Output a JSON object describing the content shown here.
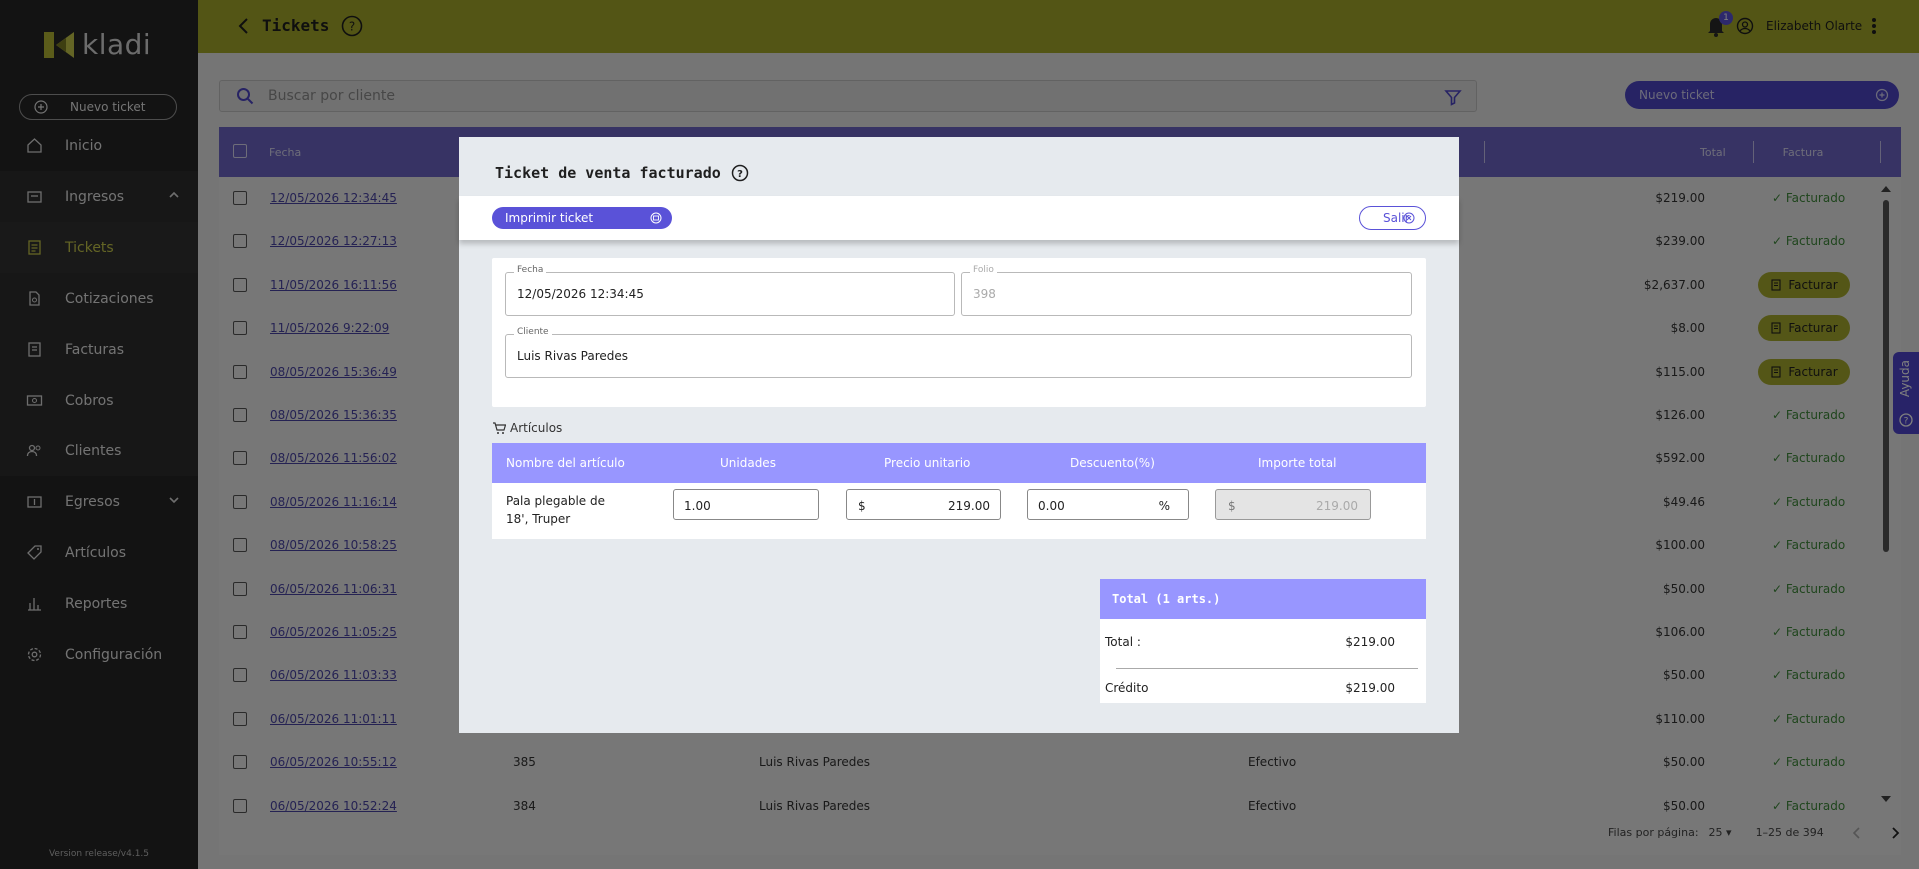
{
  "app": {
    "logo_text": "kladi",
    "version": "Version release/v4.1.5",
    "brand_color": "#a7ab2a",
    "accent_color": "#5a52d8"
  },
  "sidebar": {
    "new_ticket": "Nuevo ticket",
    "items": [
      {
        "label": "Inicio",
        "icon": "home-icon"
      },
      {
        "label": "Ingresos",
        "icon": "cash-register-icon"
      },
      {
        "label": "Tickets",
        "icon": "receipt-icon"
      },
      {
        "label": "Cotizaciones",
        "icon": "document-icon"
      },
      {
        "label": "Facturas",
        "icon": "invoice-icon"
      },
      {
        "label": "Cobros",
        "icon": "money-icon"
      },
      {
        "label": "Clientes",
        "icon": "users-icon"
      },
      {
        "label": "Egresos",
        "icon": "expense-icon"
      },
      {
        "label": "Artículos",
        "icon": "tag-icon"
      },
      {
        "label": "Reportes",
        "icon": "chart-icon"
      },
      {
        "label": "Configuración",
        "icon": "gear-icon"
      }
    ]
  },
  "topbar": {
    "title": "Tickets",
    "notifications": "1",
    "user": "Elizabeth Olarte"
  },
  "search": {
    "placeholder": "Buscar por cliente"
  },
  "new_ticket_button": "Nuevo ticket",
  "table": {
    "headers": {
      "fecha": "Fecha",
      "total": "Total",
      "factura": "Factura"
    },
    "facturado_label": "✓ Facturado",
    "facturar_label": "Facturar",
    "rows": [
      {
        "date": "12/05/2026   12:34:45",
        "total": "$219.00",
        "status": "facturado"
      },
      {
        "date": "12/05/2026   12:27:13",
        "total": "$239.00",
        "status": "facturado"
      },
      {
        "date": "11/05/2026   16:11:56",
        "total": "$2,637.00",
        "status": "facturar"
      },
      {
        "date": "11/05/2026   9:22:09",
        "total": "$8.00",
        "status": "facturar"
      },
      {
        "date": "08/05/2026   15:36:49",
        "total": "$115.00",
        "status": "facturar"
      },
      {
        "date": "08/05/2026   15:36:35",
        "total": "$126.00",
        "status": "facturado"
      },
      {
        "date": "08/05/2026   11:56:02",
        "total": "$592.00",
        "status": "facturado"
      },
      {
        "date": "08/05/2026   11:16:14",
        "total": "$49.46",
        "status": "facturado"
      },
      {
        "date": "08/05/2026   10:58:25",
        "total": "$100.00",
        "status": "facturado"
      },
      {
        "date": "06/05/2026   11:06:31",
        "total": "$50.00",
        "status": "facturado"
      },
      {
        "date": "06/05/2026   11:05:25",
        "total": "$106.00",
        "status": "facturado"
      },
      {
        "date": "06/05/2026   11:03:33",
        "total": "$50.00",
        "status": "facturado"
      },
      {
        "date": "06/05/2026   11:01:11",
        "total": "$110.00",
        "status": "facturado"
      },
      {
        "date": "06/05/2026   10:55:12",
        "folio": "385",
        "client": "Luis Rivas Paredes",
        "method": "Efectivo",
        "total": "$50.00",
        "status": "facturado"
      },
      {
        "date": "06/05/2026   10:52:24",
        "folio": "384",
        "client": "Luis Rivas Paredes",
        "method": "Efectivo",
        "total": "$50.00",
        "status": "facturado"
      }
    ]
  },
  "pager": {
    "rows_label": "Filas por página:",
    "rows_value": "25",
    "range": "1–25 de 394"
  },
  "help_tab": "Ayuda",
  "modal": {
    "title": "Ticket de venta facturado",
    "print_button": "Imprimir ticket",
    "exit_button": "Salir",
    "fecha_label": "Fecha",
    "fecha_value": "12/05/2026   12:34:45",
    "folio_label": "Folio",
    "folio_value": "398",
    "cliente_label": "Cliente",
    "cliente_value": "Luis Rivas Paredes",
    "articles_label": "Artículos",
    "articles_headers": {
      "name": "Nombre del artículo",
      "units": "Unidades",
      "price": "Precio unitario",
      "discount": "Descuento(%)",
      "amount": "Importe total"
    },
    "article": {
      "name": "Pala plegable de 18', Truper",
      "units": "1.00",
      "currency": "$",
      "price": "219.00",
      "discount": "0.00",
      "percent": "%",
      "amount": "219.00"
    },
    "totals_title": "Total (1 arts.)",
    "total_label": "Total :",
    "total_value": "$219.00",
    "credit_label": "Crédito",
    "credit_value": "$219.00"
  }
}
